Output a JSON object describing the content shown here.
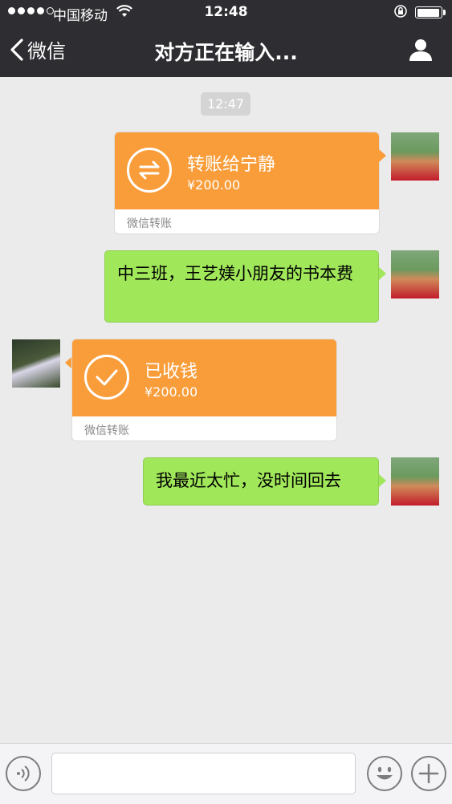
{
  "status_bar": {
    "carrier": "中国移动",
    "time": "12:48",
    "signal_bars": 4,
    "battery_level": 0.95
  },
  "nav": {
    "back_label": "微信",
    "title": "对方正在输入...",
    "profile_icon": "person-icon"
  },
  "chat": {
    "timestamp": "12:47",
    "messages": [
      {
        "sender": "me",
        "type": "transfer",
        "title": "转账给宁静",
        "amount": "¥200.00",
        "footer": "微信转账",
        "icon": "transfer-arrows-icon"
      },
      {
        "sender": "me",
        "type": "text",
        "text": "中三班，王艺媄小朋友的书本费"
      },
      {
        "sender": "other",
        "type": "transfer",
        "title": "已收钱",
        "amount": "¥200.00",
        "footer": "微信转账",
        "icon": "checkmark-icon"
      },
      {
        "sender": "me",
        "type": "text",
        "text": "我最近太忙，没时间回去"
      }
    ]
  },
  "input_bar": {
    "value": "",
    "voice_icon": "voice-icon",
    "emoji_icon": "emoji-icon",
    "add_icon": "plus-icon"
  },
  "colors": {
    "nav_bg": "#2e2e32",
    "chat_bg": "#ebebeb",
    "transfer_orange": "#f99d3a",
    "bubble_green": "#a0e75a"
  }
}
